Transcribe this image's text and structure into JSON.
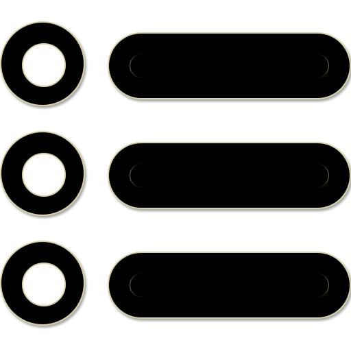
{
  "icon": {
    "name": "list-icon",
    "item_count": 3,
    "colors": {
      "fill": "#000000",
      "outline": "#d8d2a8",
      "background": "#ffffff"
    }
  }
}
